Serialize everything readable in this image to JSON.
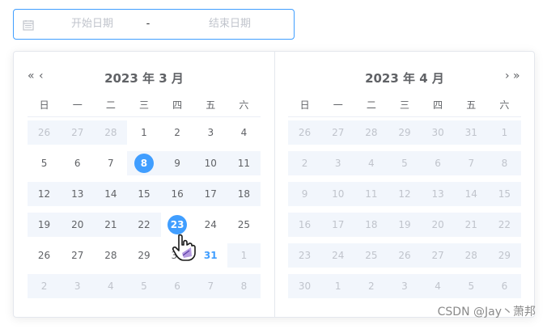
{
  "input": {
    "start_placeholder": "开始日期",
    "separator": "-",
    "end_placeholder": "结束日期"
  },
  "left_panel": {
    "title": "2023 年 3 月",
    "prev_year": "«",
    "prev_month": "‹",
    "weekdays": [
      "日",
      "一",
      "二",
      "三",
      "四",
      "五",
      "六"
    ],
    "weeks": [
      [
        "26",
        "27",
        "28",
        "1",
        "2",
        "3",
        "4"
      ],
      [
        "5",
        "6",
        "7",
        "8",
        "9",
        "10",
        "11"
      ],
      [
        "12",
        "13",
        "14",
        "15",
        "16",
        "17",
        "18"
      ],
      [
        "19",
        "20",
        "21",
        "22",
        "23",
        "24",
        "25"
      ],
      [
        "26",
        "27",
        "28",
        "29",
        "30",
        "31",
        "1"
      ],
      [
        "2",
        "3",
        "4",
        "5",
        "6",
        "7",
        "8"
      ]
    ]
  },
  "right_panel": {
    "title": "2023 年 4 月",
    "next_month": "›",
    "next_year": "»",
    "weekdays": [
      "日",
      "一",
      "二",
      "三",
      "四",
      "五",
      "六"
    ],
    "weeks": [
      [
        "26",
        "27",
        "28",
        "29",
        "30",
        "31",
        "1"
      ],
      [
        "2",
        "3",
        "4",
        "5",
        "6",
        "7",
        "8"
      ],
      [
        "9",
        "10",
        "11",
        "12",
        "13",
        "14",
        "15"
      ],
      [
        "16",
        "17",
        "18",
        "19",
        "20",
        "21",
        "22"
      ],
      [
        "23",
        "24",
        "25",
        "26",
        "27",
        "28",
        "29"
      ],
      [
        "30",
        "1",
        "2",
        "3",
        "4",
        "5",
        "6"
      ]
    ]
  },
  "state": {
    "range_start": "2023-03-08",
    "range_end": "2023-03-23",
    "today": "2023-03-31"
  },
  "colors": {
    "accent": "#409eff",
    "range_bg": "#f2f6fc",
    "muted_text": "#c0c4cc",
    "text": "#606266"
  },
  "watermark": "CSDN @Jay丶萧邦"
}
